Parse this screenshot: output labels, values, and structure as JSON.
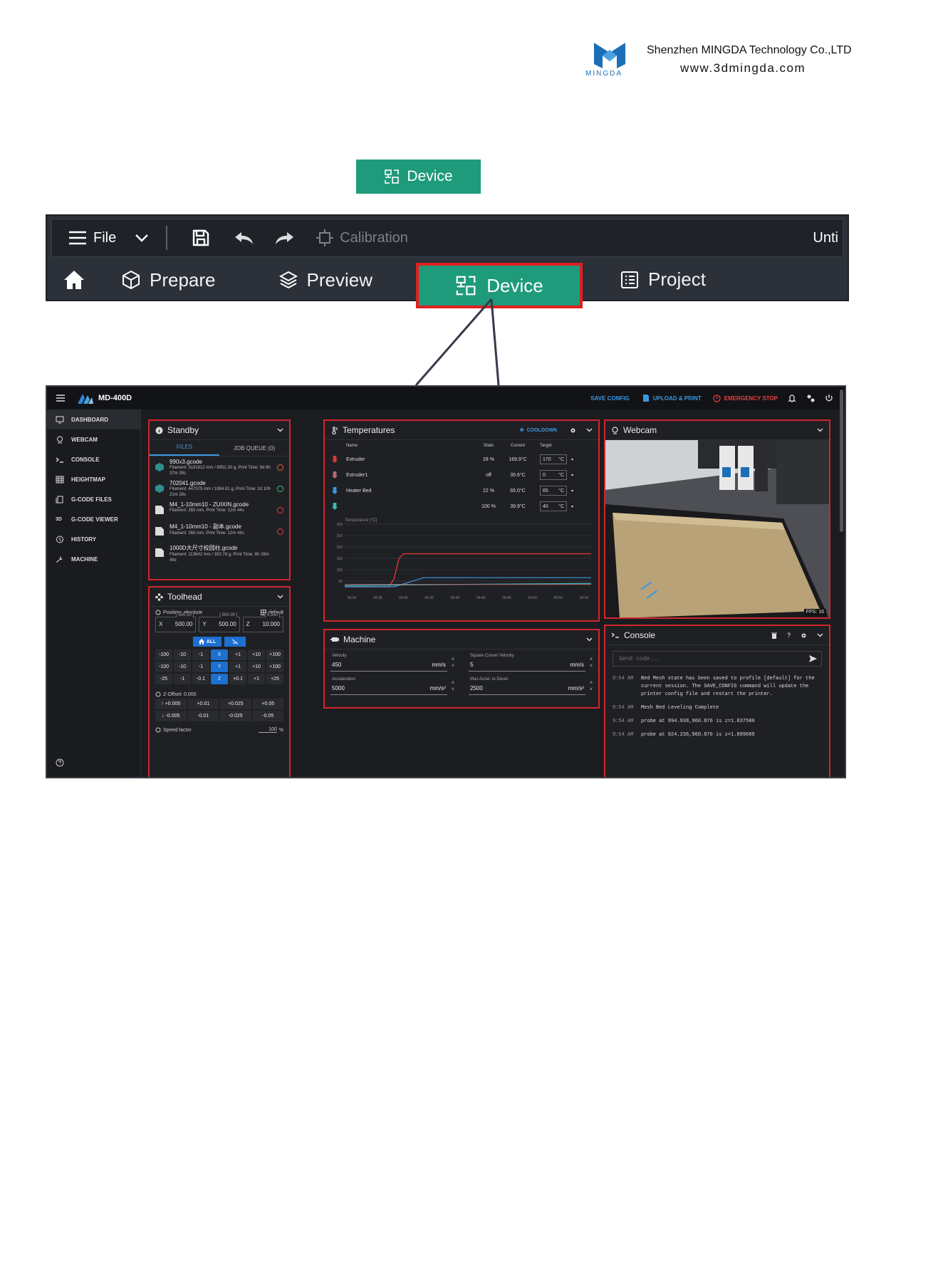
{
  "header": {
    "logo_word": "MINGDA",
    "company": "Shenzhen MINGDA Technology Co.,LTD",
    "website": "www.3dmingda.com"
  },
  "device_sample": {
    "label": "Device"
  },
  "toolbar": {
    "file": "File",
    "calibration": "Calibration",
    "title_partial": "Unti",
    "tabs": {
      "prepare": "Prepare",
      "preview": "Preview",
      "device": "Device",
      "project": "Project"
    }
  },
  "dashboard": {
    "printer_name": "MD-400D",
    "top_actions": {
      "save_config": "SAVE CONFIG",
      "upload_print": "UPLOAD & PRINT",
      "emergency": "EMERGENCY STOP"
    },
    "sidebar": [
      {
        "label": "DASHBOARD"
      },
      {
        "label": "WEBCAM"
      },
      {
        "label": "CONSOLE"
      },
      {
        "label": "HEIGHTMAP"
      },
      {
        "label": "G-CODE FILES"
      },
      {
        "label": "G-CODE VIEWER"
      },
      {
        "label": "HISTORY"
      },
      {
        "label": "MACHINE"
      }
    ],
    "standby": {
      "title": "Standby",
      "tab_files": "FILES",
      "tab_queue": "JOB QUEUE (0)",
      "files": [
        {
          "name": "990x3.gcode",
          "meta": "Filament: 3181612 mm / 8952.30 g, Print Time: 9d 6h 37m 39s",
          "status_color": "#e0662c"
        },
        {
          "name": "702041.gcode",
          "meta": "Filament: 447375 mm / 1884.81 g, Print Time: 2d 10h 21m 28s",
          "status_color": "#3bbf6b"
        },
        {
          "name": "M4_1-10mm10 - ZUIXIN.gcode",
          "meta": "Filament: 265 mm, Print Time: 12m 44s",
          "status_color": "#e84040"
        },
        {
          "name": "M4_1-10mm10 - 副本.gcode",
          "meta": "Filament: 265 mm, Print Time: 12m 44s",
          "status_color": "#e84040"
        },
        {
          "name": "1000D大尺寸校园柱.gcode",
          "meta": "Filament: 113642 mm / 333.78 g, Print Time: 8h 28m 49s",
          "status_color": ""
        }
      ]
    },
    "toolhead": {
      "title": "Toolhead",
      "position_label": "Position: absolute",
      "profile": "default",
      "axes": [
        {
          "axis": "X",
          "limit": "[ 500.00 ]",
          "value": "500.00"
        },
        {
          "axis": "Y",
          "limit": "[ 500.00 ]",
          "value": "500.00"
        },
        {
          "axis": "Z",
          "limit": "[ 9.950 ]",
          "value": "10.000"
        }
      ],
      "home_all": "ALL",
      "jog_rows": [
        [
          "-100",
          "-10",
          "-1",
          "X",
          "+1",
          "+10",
          "+100"
        ],
        [
          "-100",
          "-10",
          "-1",
          "Y",
          "+1",
          "+10",
          "+100"
        ],
        [
          "-25",
          "-1",
          "-0.1",
          "Z",
          "+0.1",
          "+1",
          "+25"
        ]
      ],
      "z_offset": "Z-Offset: 0.000",
      "z_up": [
        "+0.005",
        "+0.01",
        "+0.025",
        "+0.05"
      ],
      "z_down": [
        "-0.005",
        "-0.01",
        "-0.025",
        "-0.05"
      ],
      "speed_factor": "Speed factor",
      "speed_value": "100",
      "speed_unit": "%"
    },
    "temperatures": {
      "title": "Temperatures",
      "cooldown": "COOLDOWN",
      "cols": {
        "name": "Name",
        "state": "State",
        "current": "Current",
        "target": "Target"
      },
      "rows": [
        {
          "name": "Extruder",
          "state": "28 %",
          "current": "169.9°C",
          "target": "170",
          "unit": "°C",
          "color": "#d93636"
        },
        {
          "name": "Extruder1",
          "state": "off",
          "current": "35.6°C",
          "target": "0",
          "unit": "°C",
          "color": "#b56a6a"
        },
        {
          "name": "Heater Bed",
          "state": "22 %",
          "current": "65.0°C",
          "target": "65",
          "unit": "°C",
          "color": "#3b97e0"
        },
        {
          "name": "",
          "state": "100 %",
          "current": "39.9°C",
          "target": "40",
          "unit": "°C",
          "color": "#3bb7b7"
        }
      ],
      "chart_label": "Temperature [°C]",
      "y_ticks": [
        "300",
        "250",
        "200",
        "150",
        "100",
        "50"
      ],
      "x_ticks": [
        "09:36",
        "09:38",
        "09:40",
        "09:42",
        "09:44",
        "09:46",
        "09:48",
        "09:50",
        "09:52",
        "09:54"
      ]
    },
    "webcam": {
      "title": "Webcam",
      "fps": "FPS: 16"
    },
    "machine": {
      "title": "Machine",
      "fields": [
        {
          "label": "Velocity",
          "value": "450",
          "unit": "mm/s"
        },
        {
          "label": "Square Corner Velocity",
          "value": "5",
          "unit": "mm/s"
        },
        {
          "label": "Acceleration",
          "value": "5000",
          "unit": "mm/s²"
        },
        {
          "label": "Max Accel. to Decel.",
          "value": "2500",
          "unit": "mm/s²"
        }
      ]
    },
    "console": {
      "title": "Console",
      "placeholder": "Send code...",
      "lines": [
        {
          "time": "9:54 AM",
          "text": "Bed Mesh state has been saved to profile [default] for the current session. The SAVE_CONFIG command will update the printer config file and restart the printer."
        },
        {
          "time": "9:54 AM",
          "text": "Mesh Bed Leveling Complete"
        },
        {
          "time": "9:54 AM",
          "text": "probe at 994.938,960.876 is z=1.837500"
        },
        {
          "time": "9:54 AM",
          "text": "probe at 924.236,960.876 is z=1.899689"
        }
      ]
    }
  }
}
